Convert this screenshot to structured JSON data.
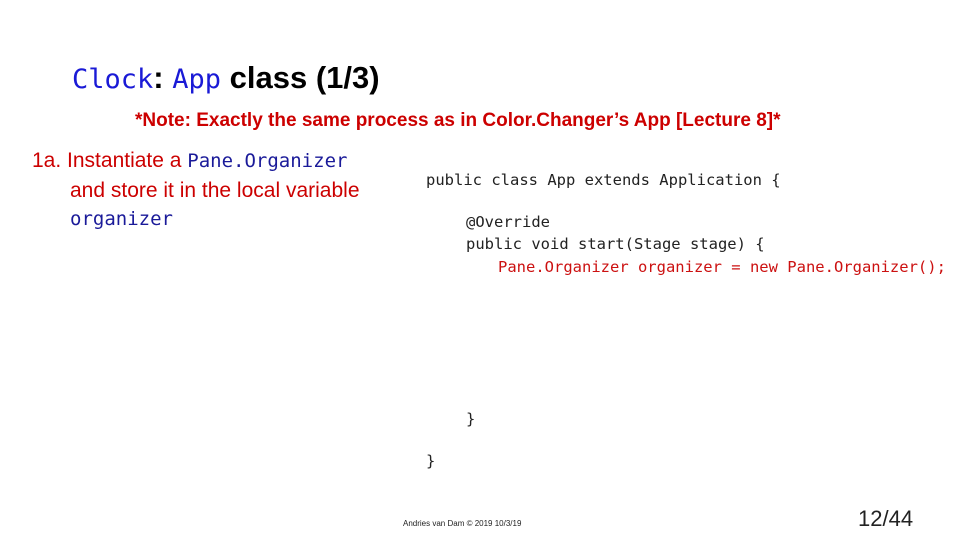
{
  "slide": {
    "title": {
      "class_name": "Clock",
      "separator": ":",
      "app_name": "App",
      "suffix": " class (1/3)"
    },
    "note": "*Note: Exactly the same process as in Color.Changer’s App [Lecture 8]*",
    "step": {
      "number": "1a.",
      "text_before": " Instantiate a ",
      "type_name": "Pane.Organizer",
      "line2": "and store it in the local variable",
      "var_name": "organizer"
    },
    "code": [
      "public class App extends Application {",
      "@Override",
      "public void start(Stage stage) {",
      "Pane.Organizer organizer = new Pane.Organizer();",
      "}",
      "}"
    ],
    "footer": "Andries van Dam © 2019 10/3/19",
    "page_number": "12/44"
  },
  "colors": {
    "title_code": "#1a1ad6",
    "accent_red": "#cc0000",
    "step_code": "#1a1a99",
    "code_text": "#222222"
  }
}
